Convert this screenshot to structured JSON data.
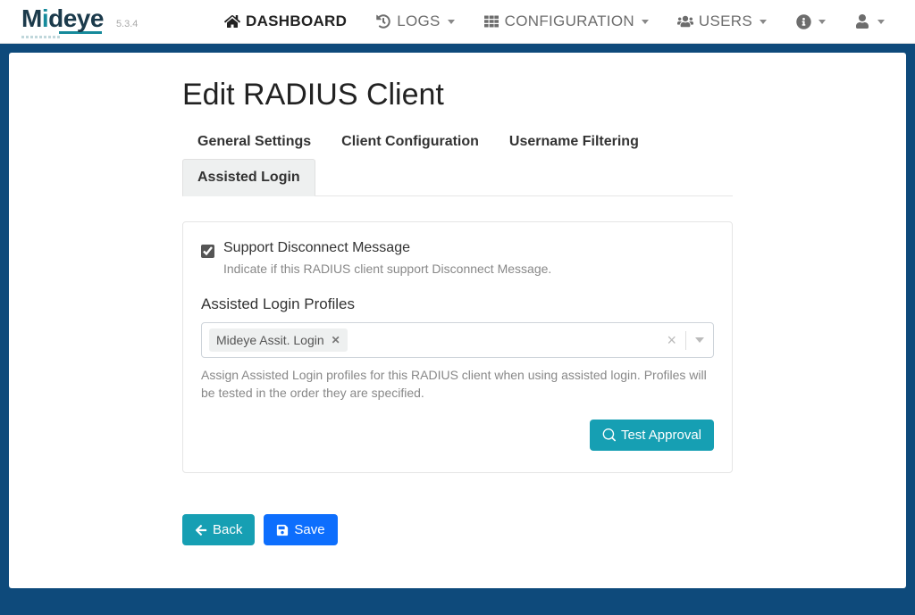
{
  "brand": {
    "name_part1": "M",
    "name_accent": "i",
    "name_part2": "deye",
    "version": "5.3.4"
  },
  "nav": {
    "dashboard": "DASHBOARD",
    "logs": "LOGS",
    "configuration": "CONFIGURATION",
    "users": "USERS"
  },
  "page": {
    "title": "Edit RADIUS Client",
    "tabs": {
      "general": "General Settings",
      "clientconf": "Client Configuration",
      "userfilter": "Username Filtering",
      "assisted": "Assisted Login"
    },
    "support_disconnect": {
      "label": "Support Disconnect Message",
      "help": "Indicate if this RADIUS client support Disconnect Message.",
      "checked": true
    },
    "assisted_profiles": {
      "label": "Assisted Login Profiles",
      "tags": [
        "Mideye Assit. Login"
      ],
      "help": "Assign Assisted Login profiles for this RADIUS client when using assisted login. Profiles will be tested in the order they are specified."
    },
    "test_approval": "Test Approval",
    "back": "Back",
    "save": "Save"
  }
}
